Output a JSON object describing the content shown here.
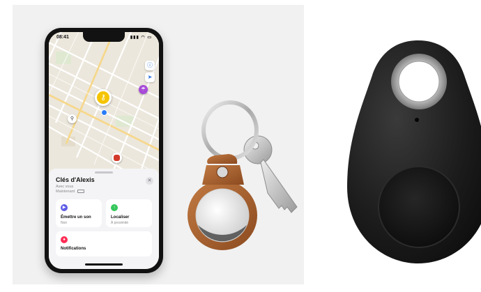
{
  "phone": {
    "status_time": "08:41",
    "status_icons": "▮▮▮ ◠ ▭",
    "map_info_icon": "ⓘ",
    "map_locate_icon": "➤",
    "sheet": {
      "title": "Clés d'Alexis",
      "with_you": "Avec vous",
      "now": "Maintenant",
      "close_glyph": "✕",
      "tiles": {
        "play_sound": {
          "label": "Émettre un son",
          "sub": "Non"
        },
        "locate": {
          "label": "Localiser",
          "sub": "À proximité"
        },
        "notifications": {
          "label": "Notifications"
        }
      }
    }
  },
  "colors": {
    "play_icon": "#5e5ce6",
    "locate_icon": "#34c759",
    "notify_icon": "#ff2d55",
    "map_pin": "#f5c400",
    "leather": "#a8602c",
    "tracker_black": "#1c1c1c"
  },
  "icons": [
    "key-pin-icon",
    "bike-icon",
    "umbrella-icon",
    "backpack-icon",
    "play-icon",
    "locate-icon",
    "bell-icon",
    "info-icon",
    "location-arrow-icon",
    "close-icon"
  ]
}
